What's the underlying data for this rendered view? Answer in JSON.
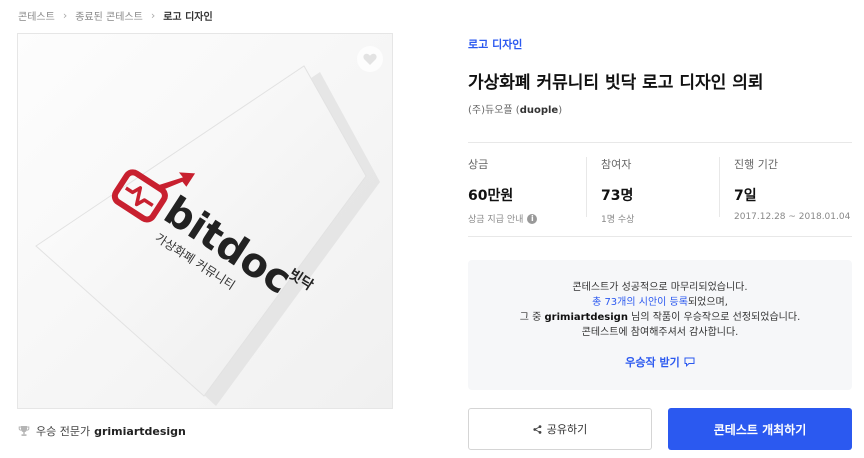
{
  "breadcrumb": [
    "콘테스트",
    "종료된 콘테스트",
    "로고 디자인"
  ],
  "winner": {
    "prefix": "우승 전문가",
    "name": "grimiartdesign"
  },
  "artwork": {
    "brand": "bitdoc",
    "brand_korean": "빗닥",
    "tagline": "가상화폐 커뮤니티",
    "accent_color": "#c8202f"
  },
  "contest": {
    "category": "로고 디자인",
    "title": "가상화폐 커뮤니티 빗닥 로고 디자인 의뢰",
    "company_prefix": "(주)듀오플",
    "company_name": "duople"
  },
  "stats": [
    {
      "label": "상금",
      "value": "60만원",
      "sub": "상금 지급 안내"
    },
    {
      "label": "참여자",
      "value": "73명",
      "sub": "1명 수상"
    },
    {
      "label": "진행 기간",
      "value": "7일",
      "sub": "2017.12.28 ~ 2018.01.04"
    }
  ],
  "notice": {
    "line1": "콘테스트가 성공적으로 마무리되었습니다.",
    "line2_link": "총 73개의 시안이 등록",
    "line2_rest": "되었으며,",
    "line3_prefix": "그 중",
    "line3_name": "grimiartdesign",
    "line3_rest": "님의 작품이 우승작으로 선정되었습니다.",
    "line4": "콘테스트에 참여해주셔서 감사합니다.",
    "download": "우승작 받기"
  },
  "buttons": {
    "share": "공유하기",
    "host": "콘테스트 개최하기"
  },
  "colors": {
    "primary": "#2b59f0",
    "notice_bg": "#f6f7f9"
  }
}
